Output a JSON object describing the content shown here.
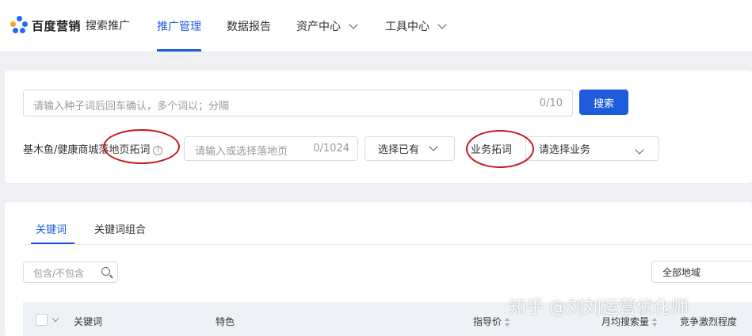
{
  "header": {
    "logo_brand": "百度营销",
    "logo_sub": "搜索推广",
    "nav": [
      "推广管理",
      "数据报告",
      "资产中心",
      "工具中心"
    ]
  },
  "search": {
    "seed_placeholder": "请输入种子词后回车确认，多个词以；分隔",
    "seed_count": "0/10",
    "search_button": "搜索"
  },
  "landing": {
    "prefix": "基木鱼/健康商城",
    "label": "落地页拓词",
    "help": "?",
    "placeholder": "请输入或选择落地页",
    "count": "0/1024",
    "select_existing": "选择已有"
  },
  "business": {
    "label": "业务拓词",
    "select_placeholder": "请选择业务"
  },
  "tabs": [
    "关键词",
    "关键词组合"
  ],
  "filter": {
    "placeholder": "包含/不包含",
    "region": "全部地域"
  },
  "table": {
    "columns": [
      "关键词",
      "特色",
      "指导价",
      "月均搜索量",
      "竞争激烈程度"
    ]
  },
  "watermark": "知乎 @刘刘运营优化师",
  "colors": {
    "accent": "#1f5bdd",
    "annotation": "#c8161d"
  }
}
